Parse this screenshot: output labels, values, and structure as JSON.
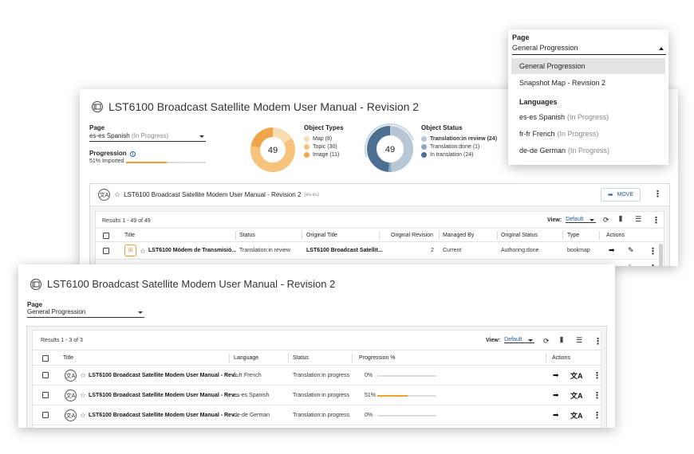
{
  "back": {
    "title": "LST6100 Broadcast Satellite Modem User Manual - Revision 2",
    "page_label": "Page",
    "page_value": "es-es Spanish",
    "page_value_status": "(In Progress)",
    "progression_label": "Progression",
    "progression_text": "51% Imported",
    "progression_pct": 51,
    "donut1": {
      "title": "Object Types",
      "center": "49",
      "items": [
        {
          "label": "Map (8)",
          "value": 8,
          "color": "#f8dcb2"
        },
        {
          "label": "Topic (30)",
          "value": 30,
          "color": "#f6c27c"
        },
        {
          "label": "Image (11)",
          "value": 11,
          "color": "#f1a54a"
        }
      ]
    },
    "donut2": {
      "title": "Object Status",
      "center": "49",
      "items": [
        {
          "label": "Translation:in review (24)",
          "value": 24,
          "color": "#b7c7d6",
          "bold": true
        },
        {
          "label": "Translation:done (1)",
          "value": 1,
          "color": "#8ca8c1",
          "bold": false
        },
        {
          "label": "In translation (24)",
          "value": 24,
          "color": "#4a6f90",
          "bold": false
        }
      ]
    },
    "sub_title": "LST6100 Broadcast Satellite Modem User Manual - Revision 2",
    "sub_lang": "(es-es)",
    "move_label": "MOVE",
    "results": "Results 1 - 49 of 49",
    "view_label": "View:",
    "view_value": "Default",
    "columns": [
      "Title",
      "Status",
      "Original Title",
      "Original Revision",
      "Managed By",
      "Original Status",
      "Type",
      "Actions"
    ],
    "row": {
      "title": "LST6100 Módem de Transmisió...",
      "status": "Translation:in review",
      "original_title": "LST6100 Broadcast Satellit...",
      "original_revision": "2",
      "managed_by": "Current",
      "original_status": "Authoring:done",
      "type": "bookmap"
    }
  },
  "dropdown": {
    "label": "Page",
    "value": "General Progression",
    "options": [
      {
        "label": "General Progression",
        "status": ""
      },
      {
        "label": "Snapshot Map - Revision 2",
        "status": ""
      }
    ],
    "group_label": "Languages",
    "languages": [
      {
        "label": "es-es Spanish",
        "status": "(In Progress)"
      },
      {
        "label": "fr-fr French",
        "status": "(In Progress)"
      },
      {
        "label": "de-de German",
        "status": "(In Progress)"
      }
    ]
  },
  "front": {
    "title": "LST6100 Broadcast Satellite Modem User Manual - Revision 2",
    "page_label": "Page",
    "page_value": "General Progression",
    "results": "Results 1 - 3 of 3",
    "view_label": "View:",
    "view_value": "Default",
    "columns": [
      "Title",
      "Language",
      "Status",
      "Progression %",
      "Actions"
    ],
    "rows": [
      {
        "title": "LST6100 Broadcast Satellite Modem User Manual - Rev...",
        "language": "fr-fr French",
        "status": "Translation:in progress",
        "progress_text": "0%",
        "progress": 0
      },
      {
        "title": "LST6100 Broadcast Satellite Modem User Manual - Rev...",
        "language": "es-es Spanish",
        "status": "Translation:in progress",
        "progress_text": "51%",
        "progress": 51
      },
      {
        "title": "LST6100 Broadcast Satellite Modem User Manual - Rev...",
        "language": "de-de German",
        "status": "Translation:in progress",
        "progress_text": "0%",
        "progress": 0
      }
    ]
  },
  "icons": {
    "map": "map-icon",
    "translate": "translate-icon",
    "star": "star-icon",
    "info": "info-icon",
    "arrow": "arrow-right-icon",
    "edit": "pencil-icon",
    "more": "more-vertical-icon",
    "columns": "columns-icon",
    "filter": "filter-icon",
    "refresh": "refresh-icon"
  }
}
